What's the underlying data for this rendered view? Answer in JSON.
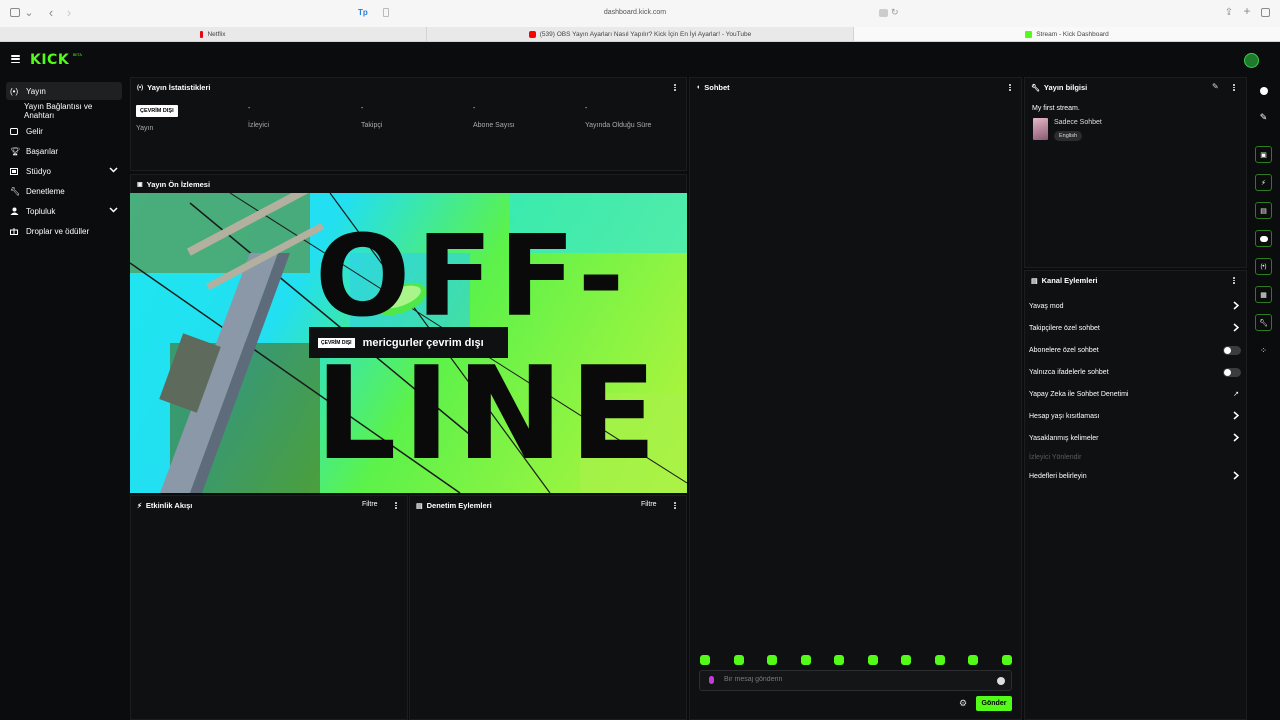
{
  "browser": {
    "url": "dashboard.kick.com",
    "tabs": [
      {
        "label": "Netflix",
        "favicon_color": "#e50914"
      },
      {
        "label": "(539) OBS Yayın Ayarları Nasıl Yapılır? Kick İçin En İyi Ayarlar! - YouTube",
        "favicon_color": "#ff0000"
      },
      {
        "label": "Stream - Kick Dashboard",
        "favicon_color": "#53fc18"
      }
    ]
  },
  "header": {
    "logo": "KICK",
    "beta": "BETA"
  },
  "sidebar": {
    "items": [
      {
        "label": "Yayın",
        "icon": "broadcast-icon",
        "active": true
      },
      {
        "label": "Yayın Bağlantısı ve Anahtarı",
        "sub": true
      },
      {
        "label": "Gelir",
        "icon": "wallet-icon"
      },
      {
        "label": "Başarılar",
        "icon": "trophy-icon"
      },
      {
        "label": "Stüdyo",
        "icon": "studio-icon",
        "expandable": true
      },
      {
        "label": "Denetleme",
        "icon": "wrench-icon"
      },
      {
        "label": "Topluluk",
        "icon": "community-icon",
        "expandable": true
      },
      {
        "label": "Droplar ve ödüller",
        "icon": "gift-icon"
      }
    ]
  },
  "stats": {
    "title": "Yayın İstatistikleri",
    "status_badge": "ÇEVRİM DIŞI",
    "status_label": "Yayın",
    "items": [
      {
        "value": "-",
        "label": "İzleyici"
      },
      {
        "value": "-",
        "label": "Takipçi"
      },
      {
        "value": "-",
        "label": "Abone Sayısı"
      },
      {
        "value": "-",
        "label": "Yayında Olduğu Süre"
      }
    ]
  },
  "preview": {
    "title": "Yayın Ön İzlemesi",
    "offline_line1": "OFF-",
    "offline_line2": "LINE",
    "card_badge": "ÇEVRİM DIŞI",
    "card_text": "mericgurler çevrim dışı"
  },
  "activity": {
    "title": "Etkinlik Akışı",
    "filter": "Filtre"
  },
  "moderation": {
    "title": "Denetim Eylemleri",
    "filter": "Filtre"
  },
  "chat": {
    "title": "Sohbet",
    "placeholder": "Bir mesaj gönderin",
    "send": "Gönder",
    "emote_count": 10
  },
  "stream_info": {
    "title": "Yayın bilgisi",
    "stream_title": "My first stream.",
    "category": "Sadece Sohbet",
    "tag": "English"
  },
  "channel_actions": {
    "title": "Kanal Eylemleri",
    "rows": [
      {
        "label": "Yavaş mod",
        "type": "arrow"
      },
      {
        "label": "Takipçilere özel sohbet",
        "type": "arrow"
      },
      {
        "label": "Abonelere özel sohbet",
        "type": "toggle"
      },
      {
        "label": "Yalnızca ifadelerle sohbet",
        "type": "toggle"
      },
      {
        "label": "Yapay Zeka ile Sohbet Denetimi",
        "type": "external"
      },
      {
        "label": "Hesap yaşı kısıtlaması",
        "type": "arrow"
      },
      {
        "label": "Yasaklanmış kelimeler",
        "type": "arrow"
      },
      {
        "label": "İzleyici Yönlendir",
        "type": "muted"
      },
      {
        "label": "Hedefleri belirleyin",
        "type": "arrow"
      }
    ]
  }
}
